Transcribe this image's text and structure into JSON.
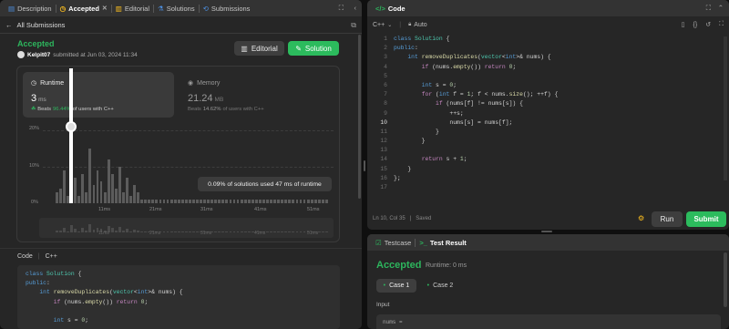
{
  "left_tabs": {
    "description": "Description",
    "accepted": "Accepted",
    "editorial": "Editorial",
    "solutions": "Solutions",
    "submissions": "Submissions"
  },
  "back_link": "All Submissions",
  "submission": {
    "status": "Accepted",
    "user": "Kelpit07",
    "submitted_text": "submitted at Jun 03, 2024 11:34",
    "editorial_btn": "Editorial",
    "solution_btn": "Solution"
  },
  "runtime": {
    "label": "Runtime",
    "value": "3",
    "unit": "ms",
    "beats_prefix": "Beats",
    "beats_pct": "96.44%",
    "beats_suffix": "of users with C++"
  },
  "memory": {
    "label": "Memory",
    "value": "21.24",
    "unit": "MB",
    "beats_prefix": "Beats",
    "beats_pct": "14.62%",
    "beats_suffix": "of users with C++"
  },
  "chart_data": {
    "type": "bar",
    "y_ticks": [
      "20%",
      "10%",
      "0%"
    ],
    "x_ticks": [
      "11ms",
      "21ms",
      "31ms",
      "41ms",
      "51ms"
    ],
    "tooltip": "0.09% of solutions used 47 ms of runtime",
    "ylim": [
      0,
      20
    ],
    "bars": [
      3,
      4,
      9,
      2,
      13,
      7,
      2,
      8,
      3,
      15,
      5,
      9,
      6,
      3,
      12,
      8,
      4,
      10,
      3,
      7,
      2,
      5,
      3,
      1,
      1,
      1,
      1,
      1,
      1,
      1,
      1,
      1,
      1,
      1,
      1,
      1,
      1,
      1,
      1,
      1,
      1,
      1,
      1,
      1,
      1,
      1,
      1,
      1,
      1,
      1,
      1,
      1,
      1,
      1,
      1,
      1,
      1,
      1,
      1,
      1,
      1,
      1,
      1,
      1,
      1,
      1,
      1,
      1,
      1,
      1,
      1,
      1,
      1,
      1
    ],
    "highlight_value": 9
  },
  "code_header": {
    "label": "Code",
    "lang": "C++"
  },
  "code_lines": [
    [
      {
        "c": "kw",
        "t": "class "
      },
      {
        "c": "ty",
        "t": "Solution"
      },
      {
        "c": "pl",
        "t": " {"
      }
    ],
    [
      {
        "c": "kw",
        "t": "public"
      },
      {
        "c": "pl",
        "t": ":"
      }
    ],
    [
      {
        "c": "pl",
        "t": "    "
      },
      {
        "c": "kw",
        "t": "int "
      },
      {
        "c": "fn",
        "t": "removeDuplicates"
      },
      {
        "c": "pl",
        "t": "("
      },
      {
        "c": "ty",
        "t": "vector"
      },
      {
        "c": "pl",
        "t": "<"
      },
      {
        "c": "kw",
        "t": "int"
      },
      {
        "c": "pl",
        "t": ">& nums) {"
      }
    ],
    [
      {
        "c": "pl",
        "t": "        "
      },
      {
        "c": "pp",
        "t": "if "
      },
      {
        "c": "pl",
        "t": "(nums."
      },
      {
        "c": "fn",
        "t": "empty"
      },
      {
        "c": "pl",
        "t": "()) "
      },
      {
        "c": "pp",
        "t": "return "
      },
      {
        "c": "nm",
        "t": "0"
      },
      {
        "c": "pl",
        "t": ";"
      }
    ],
    [
      {
        "c": "pl",
        "t": ""
      }
    ],
    [
      {
        "c": "pl",
        "t": "        "
      },
      {
        "c": "kw",
        "t": "int "
      },
      {
        "c": "pl",
        "t": "s = "
      },
      {
        "c": "nm",
        "t": "0"
      },
      {
        "c": "pl",
        "t": ";"
      }
    ],
    [
      {
        "c": "pl",
        "t": "        "
      },
      {
        "c": "pp",
        "t": "for "
      },
      {
        "c": "pl",
        "t": "("
      },
      {
        "c": "kw",
        "t": "int "
      },
      {
        "c": "pl",
        "t": "f = "
      },
      {
        "c": "nm",
        "t": "1"
      },
      {
        "c": "pl",
        "t": "; f < nums."
      },
      {
        "c": "fn",
        "t": "size"
      },
      {
        "c": "pl",
        "t": "(); ++f) {"
      }
    ],
    [
      {
        "c": "pl",
        "t": "            "
      },
      {
        "c": "pp",
        "t": "if "
      },
      {
        "c": "pl",
        "t": "(nums[f] != nums[s]) {"
      }
    ],
    [
      {
        "c": "pl",
        "t": "                ++s;"
      }
    ],
    [
      {
        "c": "pl",
        "t": "                nums[s] = nums[f];"
      }
    ],
    [
      {
        "c": "pl",
        "t": "            }"
      }
    ],
    [
      {
        "c": "pl",
        "t": "        }"
      }
    ],
    [
      {
        "c": "pl",
        "t": ""
      }
    ],
    [
      {
        "c": "pl",
        "t": "        "
      },
      {
        "c": "pp",
        "t": "return "
      },
      {
        "c": "pl",
        "t": "s + "
      },
      {
        "c": "nm",
        "t": "1"
      },
      {
        "c": "pl",
        "t": ";"
      }
    ],
    [
      {
        "c": "pl",
        "t": "    }"
      }
    ],
    [
      {
        "c": "pl",
        "t": "};"
      }
    ],
    [
      {
        "c": "pl",
        "t": ""
      }
    ]
  ],
  "editor": {
    "title": "Code",
    "lang": "C++",
    "mode": "Auto",
    "status_pos": "Ln 10, Col 35",
    "status_saved": "Saved",
    "run_btn": "Run",
    "submit_btn": "Submit"
  },
  "result": {
    "testcase_tab": "Testcase",
    "result_tab": "Test Result",
    "status": "Accepted",
    "runtime": "Runtime: 0 ms",
    "cases": [
      "Case 1",
      "Case 2"
    ],
    "input_label": "Input",
    "input_value": "nums ="
  },
  "colors": {
    "accent_green": "#2cbb5d",
    "status_green": "#2db55d",
    "yellow": "#ffc01e"
  }
}
